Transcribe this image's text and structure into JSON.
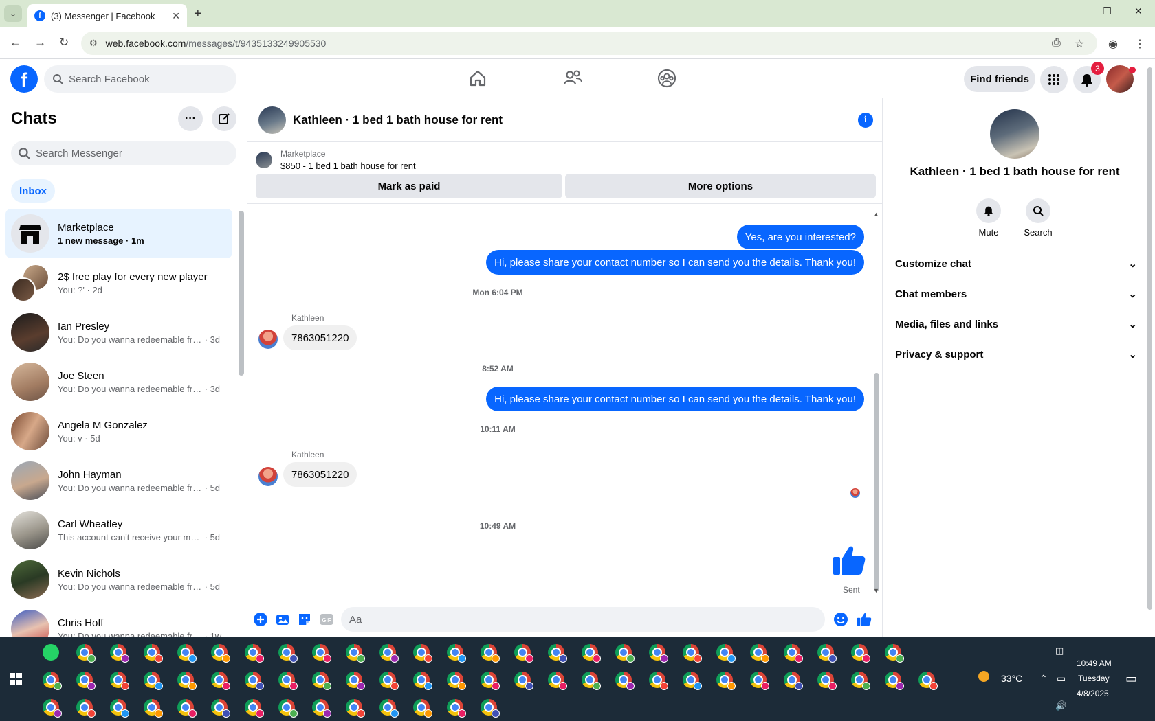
{
  "browser": {
    "tab_title": "(3) Messenger | Facebook",
    "url_host": "web.facebook.com",
    "url_path": "/messages/t/9435133249905530"
  },
  "header": {
    "search_placeholder": "Search Facebook",
    "find_friends": "Find friends",
    "notification_count": "3"
  },
  "sidebar": {
    "title": "Chats",
    "search_placeholder": "Search Messenger",
    "inbox_label": "Inbox",
    "chats": [
      {
        "name": "Marketplace",
        "preview": "1 new message",
        "time": "1m"
      },
      {
        "name": "2$ free play for every new player",
        "preview": "You: ?'",
        "time": "2d"
      },
      {
        "name": "Ian Presley",
        "preview": "You: Do you wanna redeemable fre...",
        "time": "3d"
      },
      {
        "name": "Joe Steen",
        "preview": "You: Do you wanna redeemable fre...",
        "time": "3d"
      },
      {
        "name": "Angela M Gonzalez",
        "preview": "You: v",
        "time": "5d"
      },
      {
        "name": "John Hayman",
        "preview": "You: Do you wanna redeemable fre...",
        "time": "5d"
      },
      {
        "name": "Carl Wheatley",
        "preview": "This account can't receive your mes...",
        "time": "5d"
      },
      {
        "name": "Kevin Nichols",
        "preview": "You: Do you wanna redeemable fre...",
        "time": "5d"
      },
      {
        "name": "Chris Hoff",
        "preview": "You: Do you wanna redeemable fre...",
        "time": "1w"
      }
    ]
  },
  "conversation": {
    "title": "Kathleen · 1 bed 1 bath house for rent",
    "marketplace_label": "Marketplace",
    "marketplace_item": "$850 - 1 bed 1 bath house for rent",
    "mark_as_paid": "Mark as paid",
    "more_options": "More options",
    "messages": {
      "out1": "Yes, are you interested?",
      "out2": "Hi, please share your contact number so I can send you the details. Thank you!",
      "ts1": "Mon 6:04 PM",
      "sender1": "Kathleen",
      "in1": "7863051220",
      "ts2": "8:52 AM",
      "out3": "Hi, please share your contact number so I can send you the details. Thank you!",
      "ts3": "10:11 AM",
      "sender2": "Kathleen",
      "in2": "7863051220",
      "ts4": "10:49 AM",
      "sent_status": "Sent"
    },
    "composer_placeholder": "Aa"
  },
  "info_panel": {
    "name": "Kathleen · 1 bed 1 bath house for rent",
    "mute": "Mute",
    "search": "Search",
    "sections": [
      "Customize chat",
      "Chat members",
      "Media, files and links",
      "Privacy & support"
    ]
  },
  "taskbar": {
    "temperature": "33°C",
    "time": "10:49 AM",
    "day": "Tuesday",
    "date": "4/8/2025"
  },
  "colors": {
    "accent": "#0866ff",
    "taskbar": "#1c2b38",
    "tab_bar": "#d9e8d2"
  }
}
